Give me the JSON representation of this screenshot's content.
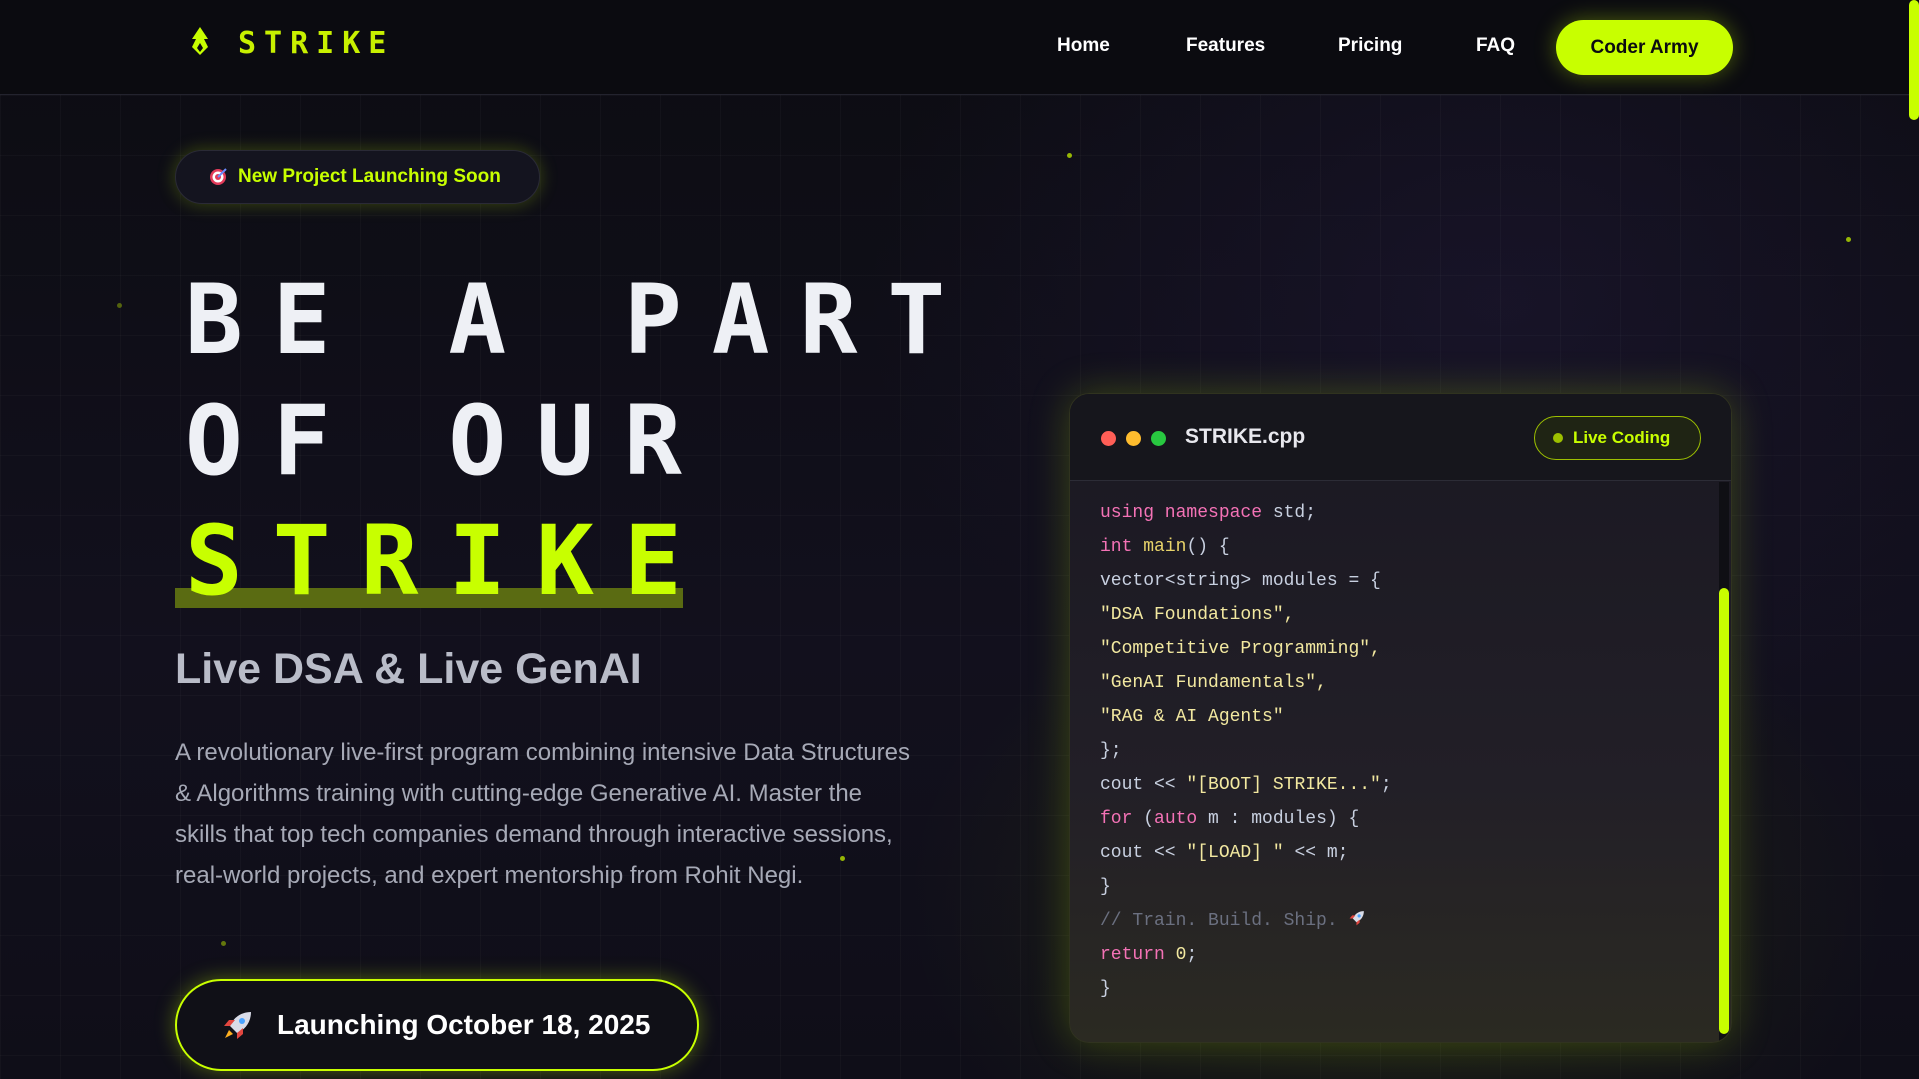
{
  "nav": {
    "logo_text": "STRIKE",
    "links": [
      "Home",
      "Features",
      "Pricing",
      "FAQ"
    ],
    "cta_label": "Coder Army"
  },
  "hero": {
    "badge_text": "New Project Launching Soon",
    "headline_line1": "BE A PART",
    "headline_line2": "OF OUR",
    "headline_line3": "STRIKE",
    "subtitle": "Live DSA & Live GenAI",
    "description": "A revolutionary live-first program combining intensive Data Structures & Algorithms training with cutting-edge Generative AI. Master the skills that top tech companies demand through interactive sessions, real-world projects, and expert mentorship from Rohit Negi.",
    "launch_text": "Launching October 18, 2025"
  },
  "code_window": {
    "file_name": "STRIKE.cpp",
    "live_label": "Live Coding",
    "lines": [
      "using namespace std;",
      "int main() {",
      "vector<string> modules = {",
      "\"DSA Foundations\",",
      "\"Competitive Programming\",",
      "\"GenAI Fundamentals\",",
      "\"RAG & AI Agents\"",
      "};",
      "cout << \"[BOOT] STRIKE...\";",
      "for (auto m : modules) {",
      "cout << \"[LOAD] \" << m;",
      "}",
      "// Train. Build. Ship.",
      "return 0;",
      "}"
    ]
  },
  "colors": {
    "accent": "#c8ff00",
    "background": "#0d0d16",
    "keyword": "#f472b6",
    "string": "#f2e8a0"
  },
  "icons": {
    "logo": "flame-icon",
    "badge": "target-icon",
    "launch": "rocket-icon",
    "comment": "rocket-icon"
  }
}
